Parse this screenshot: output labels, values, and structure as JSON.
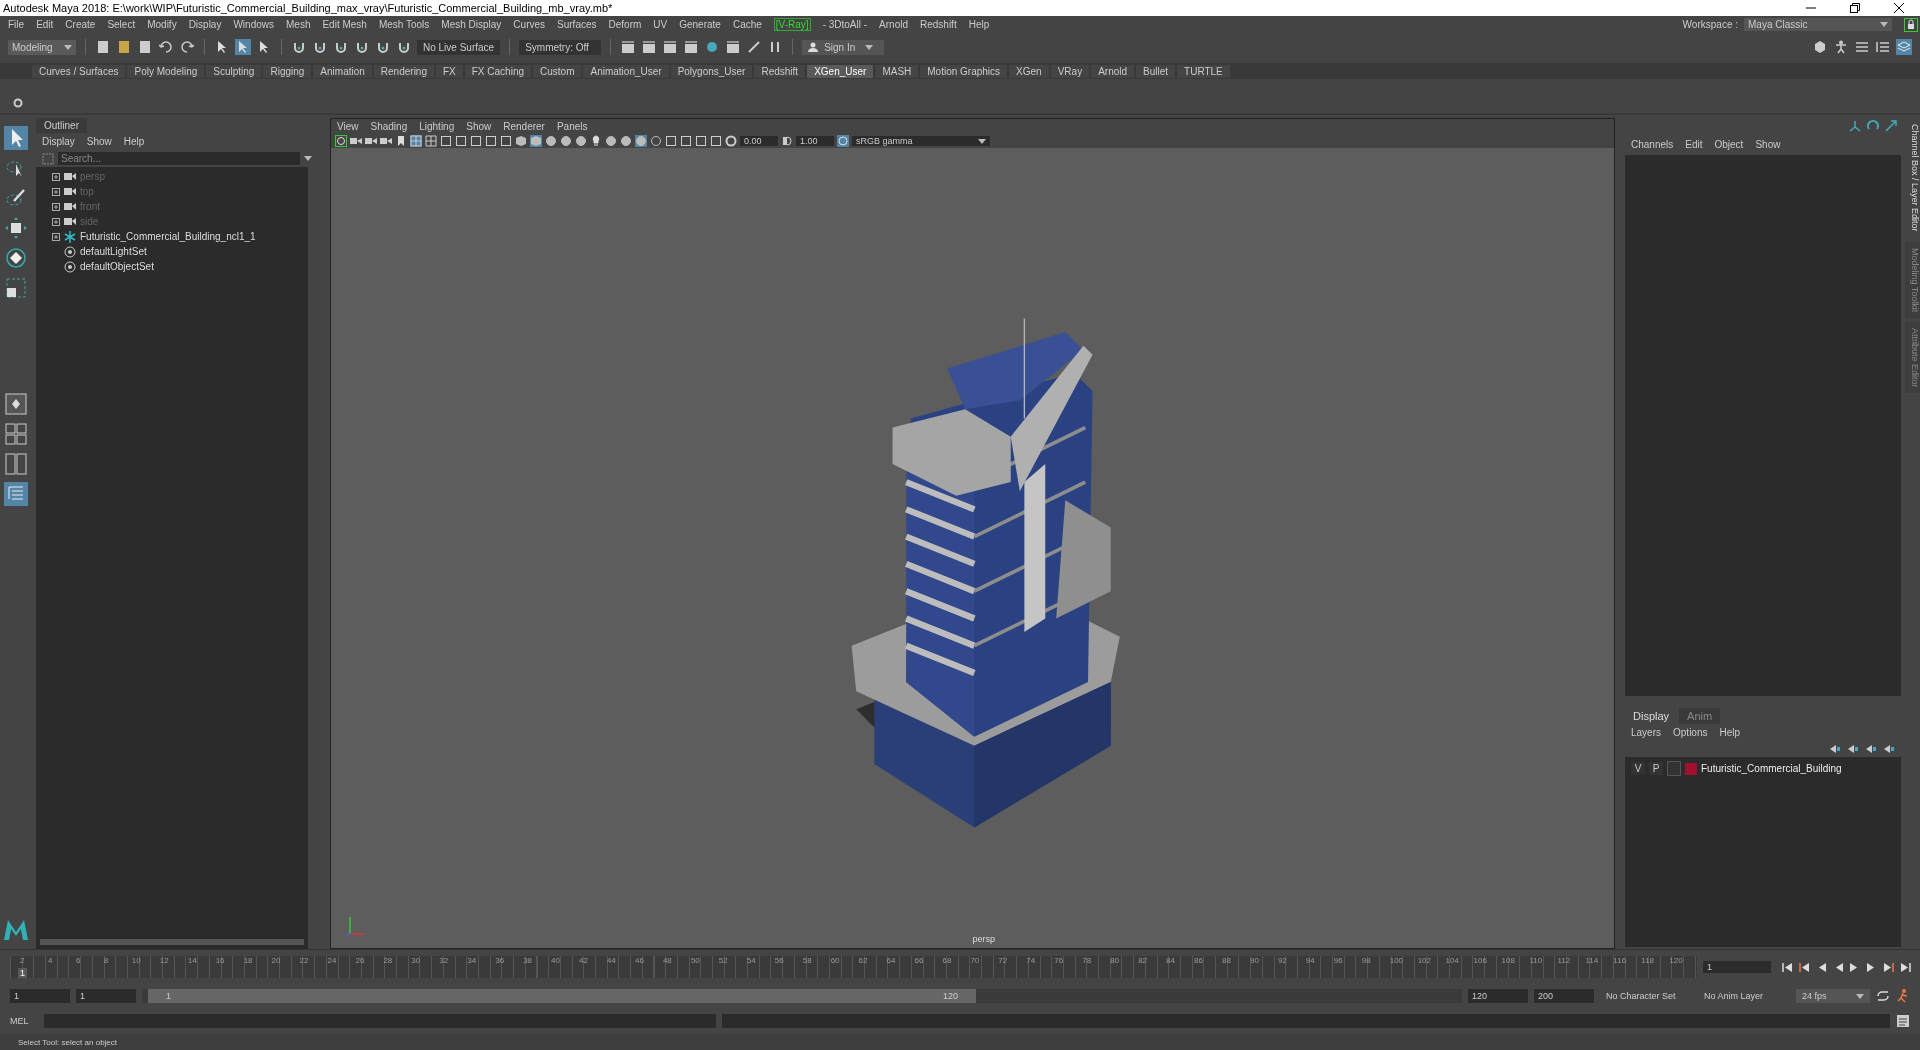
{
  "window": {
    "title": "Autodesk Maya 2018: E:\\work\\WIP\\Futuristic_Commercial_Building_max_vray\\Futuristic_Commercial_Building_mb_vray.mb*"
  },
  "menu_bar": [
    {
      "label": "File"
    },
    {
      "label": "Edit"
    },
    {
      "label": "Create"
    },
    {
      "label": "Select"
    },
    {
      "label": "Modify"
    },
    {
      "label": "Display"
    },
    {
      "label": "Windows"
    },
    {
      "label": "Mesh"
    },
    {
      "label": "Edit Mesh"
    },
    {
      "label": "Mesh Tools"
    },
    {
      "label": "Mesh Display"
    },
    {
      "label": "Curves"
    },
    {
      "label": "Surfaces"
    },
    {
      "label": "Deform"
    },
    {
      "label": "UV"
    },
    {
      "label": "Generate"
    },
    {
      "label": "Cache"
    },
    {
      "label": "[V-Ray]",
      "kind": "plugin"
    },
    {
      "label": "- 3DtoAll -"
    },
    {
      "label": "Arnold"
    },
    {
      "label": "Redshift"
    },
    {
      "label": "Help"
    }
  ],
  "toolbar": {
    "mode": "Modeling",
    "live_surface": "No Live Surface",
    "symmetry": "Symmetry: Off",
    "sign_in": "Sign In"
  },
  "workspace": {
    "label": "Workspace :",
    "value": "Maya Classic"
  },
  "shelf_tabs": [
    {
      "label": "Curves / Surfaces",
      "selected": false
    },
    {
      "label": "Poly Modeling",
      "selected": false
    },
    {
      "label": "Sculpting",
      "selected": false
    },
    {
      "label": "Rigging",
      "selected": false
    },
    {
      "label": "Animation",
      "selected": false
    },
    {
      "label": "Rendering",
      "selected": false
    },
    {
      "label": "FX",
      "selected": false
    },
    {
      "label": "FX Caching",
      "selected": false
    },
    {
      "label": "Custom",
      "selected": false
    },
    {
      "label": "Animation_User",
      "selected": false
    },
    {
      "label": "Polygons_User",
      "selected": false
    },
    {
      "label": "Redshift",
      "selected": false
    },
    {
      "label": "XGen_User",
      "selected": true
    },
    {
      "label": "MASH",
      "selected": false
    },
    {
      "label": "Motion Graphics",
      "selected": false
    },
    {
      "label": "XGen",
      "selected": false
    },
    {
      "label": "VRay",
      "selected": false
    },
    {
      "label": "Arnold",
      "selected": false
    },
    {
      "label": "Bullet",
      "selected": false
    },
    {
      "label": "TURTLE",
      "selected": false
    }
  ],
  "outliner": {
    "title": "Outliner",
    "menu": [
      "Display",
      "Show",
      "Help"
    ],
    "search_placeholder": "Search...",
    "items": [
      {
        "label": "persp",
        "kind": "camera",
        "dimmed": true
      },
      {
        "label": "top",
        "kind": "camera",
        "dimmed": true
      },
      {
        "label": "front",
        "kind": "camera",
        "dimmed": true
      },
      {
        "label": "side",
        "kind": "camera",
        "dimmed": true
      },
      {
        "label": "Futuristic_Commercial_Building_ncl1_1",
        "kind": "group",
        "dimmed": false
      },
      {
        "label": "defaultLightSet",
        "kind": "set",
        "dimmed": false
      },
      {
        "label": "defaultObjectSet",
        "kind": "set",
        "dimmed": false
      }
    ]
  },
  "viewport": {
    "menu": [
      "View",
      "Shading",
      "Lighting",
      "Show",
      "Renderer",
      "Panels"
    ],
    "exposure": "0.00",
    "gamma": "1.00",
    "color_space": "sRGB gamma",
    "camera_label": "persp"
  },
  "channel_box": {
    "menu": [
      "Channels",
      "Edit",
      "Object",
      "Show"
    ]
  },
  "side_tabs": [
    {
      "label": "Channel Box / Layer Editor",
      "selected": true
    },
    {
      "label": "Modeling Toolkit",
      "selected": false
    },
    {
      "label": "Attribute Editor",
      "selected": false
    }
  ],
  "layer_editor": {
    "tabs": [
      {
        "label": "Display",
        "selected": true
      },
      {
        "label": "Anim",
        "selected": false
      }
    ],
    "menu": [
      "Layers",
      "Options",
      "Help"
    ],
    "layers": [
      {
        "visible": "V",
        "playback": "P",
        "name": "Futuristic_Commercial_Building",
        "color": "#a3102f"
      }
    ]
  },
  "timeline": {
    "level": 0,
    "current_frame": "1",
    "frame_field": "1",
    "ticks": [
      "2",
      "4",
      "6",
      "8",
      "10",
      "12",
      "14",
      "16",
      "18",
      "20",
      "22",
      "24",
      "26",
      "28",
      "30",
      "32",
      "34",
      "36",
      "38",
      "40",
      "42",
      "44",
      "46",
      "48",
      "50",
      "52",
      "54",
      "56",
      "58",
      "60",
      "62",
      "64",
      "66",
      "68",
      "70",
      "72",
      "74",
      "76",
      "78",
      "80",
      "82",
      "84",
      "86",
      "88",
      "90",
      "92",
      "94",
      "96",
      "98",
      "100",
      "102",
      "104",
      "106",
      "108",
      "110",
      "112",
      "114",
      "116",
      "118",
      "120"
    ]
  },
  "range": {
    "level": 0.6,
    "start": "1",
    "playback_start": "1",
    "slider_start": "1",
    "slider_end": "120",
    "playback_end": "120",
    "end": "200",
    "character_set": "No Character Set",
    "anim_layer": "No Anim Layer",
    "fps": "24 fps"
  },
  "command_line": {
    "label": "MEL"
  },
  "help_line": "Select Tool: select an object"
}
